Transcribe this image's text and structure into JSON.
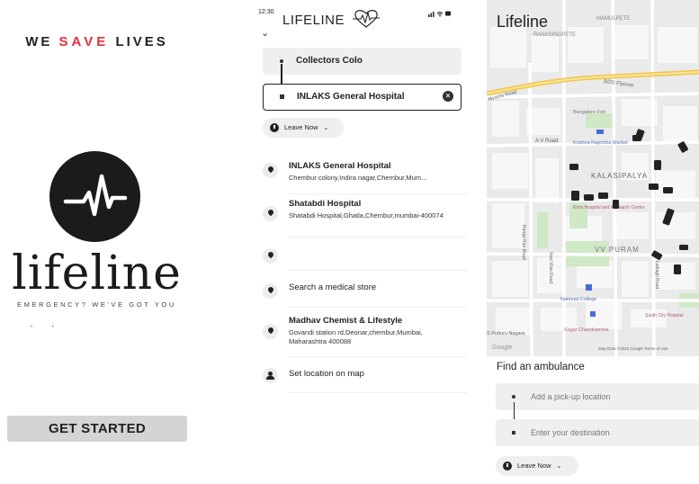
{
  "splash": {
    "tagline_part1": "WE ",
    "tagline_red": "SAVE",
    "tagline_part2": "LIVES",
    "brand_name": "lifeline",
    "brand_sub": "EMERGENCY? WE'VE GOT YOU",
    "cta": "GET STARTED",
    "accent_color": "#e2303b"
  },
  "route": {
    "status_time": "12:30",
    "status_icons": "signal wifi battery",
    "app_title": "LIFELINE",
    "back_icon": "chevron-down-icon",
    "origin": "Collectors Colo",
    "destination": "INLAKS General Hospital",
    "leave_label": "Leave Now",
    "results": [
      {
        "title": "INLAKS General Hospital",
        "subtitle": "Chembur colony,Indira nagar,Chembur,Mum..."
      },
      {
        "title": "Shatabdi Hospital",
        "subtitle": "Shatabdi Hospital,Ghatla,Chembur,mumbai-400074"
      },
      {
        "title": "",
        "subtitle": ""
      },
      {
        "title": "Search a medical store",
        "subtitle": ""
      },
      {
        "title": "Madhav Chemist & Lifestyle",
        "subtitle": "Govandi station rd,Deonar,chembur,Mumbai, Maharashtra 400088"
      },
      {
        "title": "Set location on map",
        "subtitle": ""
      }
    ]
  },
  "map_screen": {
    "title": "Lifeline",
    "map_labels": {
      "mamulpete": "MAMULPETE",
      "ranasingpete": "RANASINGPETE",
      "bds_flyover": "BDS Flyover",
      "bangalore_fort": "Bangalore Fort",
      "av_road": "A V Road",
      "krishna_market": "Krishna Rajendra Market",
      "kalasipalya": "KALASIPALYA",
      "kims": "Kims Hospital and Research Centre",
      "vv_puram": "VV PURAM",
      "national_college": "National College",
      "sagar": "Sagar Chandramma",
      "south_city": "South City Hospital",
      "putturu": "S Putturu Nagara",
      "google": "Google",
      "attribution": "Map Data ©2023 Google   Terms of Use",
      "road_left": "Mysore Road",
      "road_vertical1": "Ranga Rao Road",
      "road_vertical2": "Vani Vilas Road",
      "road_vertical3": "Lalbagh Road"
    },
    "sheet_title": "Find an ambulance",
    "pickup_placeholder": "Add a pick-up location",
    "destination_placeholder": "Enter your destination",
    "leave_label": "Leave Now"
  }
}
